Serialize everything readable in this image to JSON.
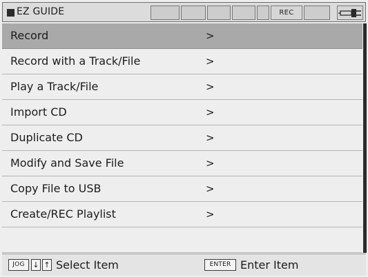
{
  "title_bar": {
    "title": "EZ GUIDE",
    "rec_label": "REC",
    "power_icon": "power-plug-icon"
  },
  "menu": {
    "arrow": ">",
    "selected_index": 0,
    "items": [
      {
        "label": "Record"
      },
      {
        "label": "Record with a Track/File"
      },
      {
        "label": "Play a Track/File"
      },
      {
        "label": "Import CD"
      },
      {
        "label": "Duplicate CD"
      },
      {
        "label": "Modify and Save File"
      },
      {
        "label": "Copy File to USB"
      },
      {
        "label": "Create/REC Playlist"
      }
    ]
  },
  "help_bar": {
    "jog_key": "JOG",
    "down_key": "↓",
    "up_key": "↑",
    "select_text": "Select Item",
    "enter_key": "ENTER",
    "enter_text": "Enter Item"
  },
  "colors": {
    "selected_row": "#a9a9a9",
    "background": "#eeeeee",
    "text": "#1c1c1c"
  }
}
